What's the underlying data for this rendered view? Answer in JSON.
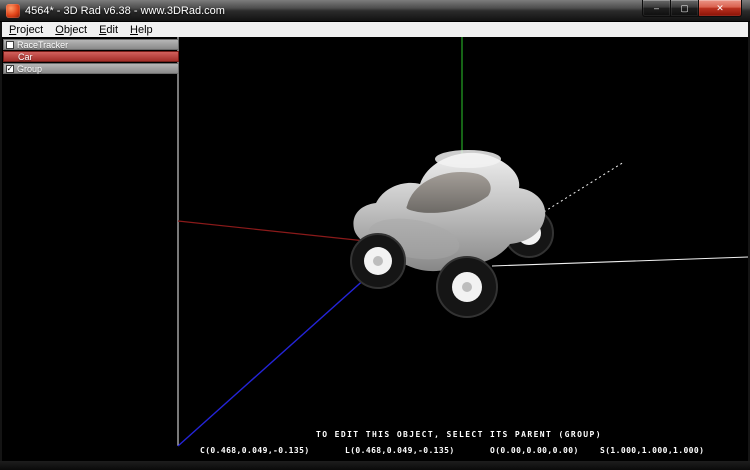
{
  "window": {
    "title": "4564* - 3D Rad v6.38 - www.3DRad.com",
    "minimize_glyph": "–",
    "maximize_glyph": "▢",
    "close_glyph": "✕"
  },
  "menu": {
    "items": [
      {
        "first": "P",
        "rest": "roject"
      },
      {
        "first": "O",
        "rest": "bject"
      },
      {
        "first": "E",
        "rest": "dit"
      },
      {
        "first": "H",
        "rest": "elp"
      }
    ]
  },
  "object_list": {
    "items": [
      {
        "label": "RaceTracker",
        "check": ""
      },
      {
        "label": "Car",
        "check": ""
      },
      {
        "label": "Group",
        "check": "✓"
      }
    ]
  },
  "viewport": {
    "hint_text": "TO EDIT THIS OBJECT, SELECT ITS PARENT (GROUP)",
    "coords": [
      "C(0.468,0.049,-0.135)",
      "L(0.468,0.049,-0.135)",
      "O(0.00,0.00,0.00)",
      "S(1.000,1.000,1.000)"
    ],
    "axis_colors": {
      "x_axis": "#8b1a1a",
      "y_axis": "#1f8f1f",
      "z_axis": "#2424d8",
      "grid": "#f2f2f2"
    }
  }
}
